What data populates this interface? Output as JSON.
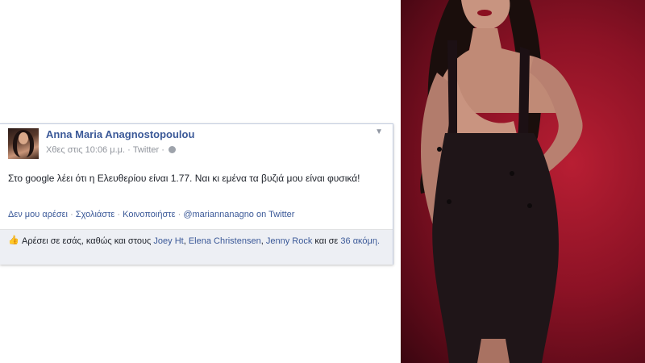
{
  "post": {
    "author": "Anna Maria Anagnostopoulou",
    "timestamp": "Χθες στις 10:06 μ.μ.",
    "source": "Twitter",
    "text": "Στο google λέει ότι η Ελευθερίου είναι 1.77. Ναι κι εμένα τα βυζιά μου είναι φυσικά!",
    "actions": {
      "unlike": "Δεν μου αρέσει",
      "comment": "Σχολιάστε",
      "share": "Κοινοποιήστε",
      "twitter_handle": "@mariannanagno on Twitter"
    },
    "likes": {
      "prefix": "Αρέσει σε εσάς, καθώς και στους",
      "user1": "Joey Ht",
      "user2": "Elena Christensen",
      "user3": "Jenny Rock",
      "and_in": "και σε",
      "count": "36",
      "suffix": "ακόμη."
    }
  },
  "icons": {
    "chevron": "chevron-down-icon",
    "globe": "globe-icon",
    "like": "thumbs-up-icon"
  },
  "colors": {
    "link": "#3b5998",
    "meta": "#90949c",
    "like_bar": "#edeff4"
  }
}
